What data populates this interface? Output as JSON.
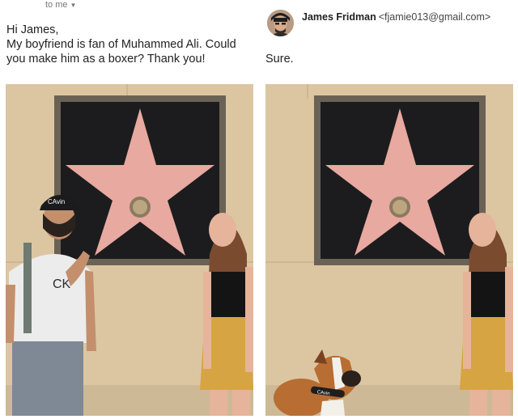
{
  "left_email": {
    "recipient_label": "to me",
    "greeting": "Hi James,",
    "body_line_1": "My boyfriend is fan of Muhammed Ali. Could",
    "body_line_2": "you make him as a boxer? Thank you!"
  },
  "right_email": {
    "sender_name": "James Fridman",
    "sender_email": "<fjamie013@gmail.com>",
    "reply_text": "Sure."
  },
  "photos": {
    "left": {
      "cap_text": "CAvin",
      "shirt_text": "CK"
    },
    "right": {
      "collar_text": "CAvin"
    }
  },
  "icons": {
    "dropdown": "chevron-down-icon",
    "avatar": "user-avatar"
  },
  "colors": {
    "wall": "#d8c19d",
    "star_plaque": "#1c1c1e",
    "star": "#e8a9a0",
    "frame": "#6b6256",
    "skirt": "#d6a443"
  }
}
